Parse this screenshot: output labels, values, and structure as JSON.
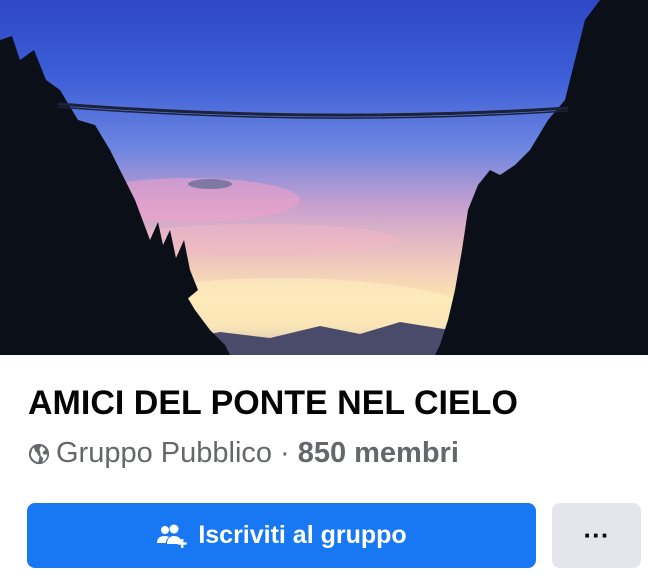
{
  "group": {
    "name": "AMICI DEL PONTE NEL CIELO",
    "privacy": "Gruppo Pubblico",
    "separator": "·",
    "members": "850 membri"
  },
  "actions": {
    "join_label": "Iscriviti al gruppo",
    "more_label": "···"
  },
  "icons": {
    "privacy": "globe-icon",
    "join": "people-add-icon"
  },
  "colors": {
    "primary": "#1877f2",
    "secondary_button": "#e4e6eb",
    "text_primary": "#050505",
    "text_secondary": "#65676b"
  }
}
